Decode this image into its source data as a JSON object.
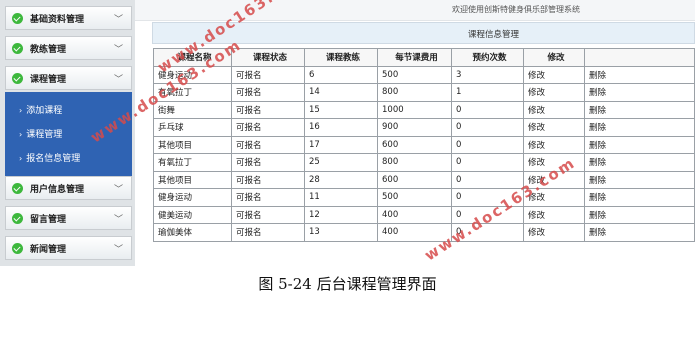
{
  "header": {
    "welcome": "欢迎使用创斯特健身俱乐部管理系统"
  },
  "sidebar": {
    "sections": [
      {
        "label": "基础资料管理",
        "icon": "check-circle-icon",
        "expand": "chevron-down-icon"
      },
      {
        "label": "教练管理",
        "icon": "check-circle-icon",
        "expand": "chevron-down-icon"
      },
      {
        "label": "课程管理",
        "icon": "check-circle-icon",
        "expand": "chevron-down-icon"
      },
      {
        "label": "用户信息管理",
        "icon": "check-circle-icon",
        "expand": "chevron-down-icon"
      },
      {
        "label": "留言管理",
        "icon": "check-circle-icon",
        "expand": "chevron-down-icon"
      },
      {
        "label": "新闻管理",
        "icon": "check-circle-icon",
        "expand": "chevron-down-icon"
      }
    ],
    "submenu": [
      {
        "label": "添加课程"
      },
      {
        "label": "课程管理"
      },
      {
        "label": "报名信息管理"
      }
    ],
    "active_color": "#2f63b3"
  },
  "main": {
    "panel_title": "课程信息管理",
    "columns": [
      "课程名称",
      "课程状态",
      "课程教练",
      "每节课费用",
      "预约次数",
      "修改",
      ""
    ],
    "rows": [
      [
        "健身运动",
        "可报名",
        "6",
        "500",
        "3",
        "修改",
        "删除"
      ],
      [
        "有氧拉丁",
        "可报名",
        "14",
        "800",
        "1",
        "修改",
        "删除"
      ],
      [
        "街舞",
        "可报名",
        "15",
        "1000",
        "0",
        "修改",
        "删除"
      ],
      [
        "乒乓球",
        "可报名",
        "16",
        "900",
        "0",
        "修改",
        "删除"
      ],
      [
        "其他项目",
        "可报名",
        "17",
        "600",
        "0",
        "修改",
        "删除"
      ],
      [
        "有氧拉丁",
        "可报名",
        "25",
        "800",
        "0",
        "修改",
        "删除"
      ],
      [
        "其他项目",
        "可报名",
        "28",
        "600",
        "0",
        "修改",
        "删除"
      ],
      [
        "健身运动",
        "可报名",
        "11",
        "500",
        "0",
        "修改",
        "删除"
      ],
      [
        "健美运动",
        "可报名",
        "12",
        "400",
        "0",
        "修改",
        "删除"
      ],
      [
        "瑜伽美体",
        "可报名",
        "13",
        "400",
        "0",
        "修改",
        "删除"
      ]
    ]
  },
  "watermarks": [
    "www.doc163.com",
    "www.doc163.com",
    "www.doc163.com"
  ],
  "caption": "图 5-24  后台课程管理界面"
}
